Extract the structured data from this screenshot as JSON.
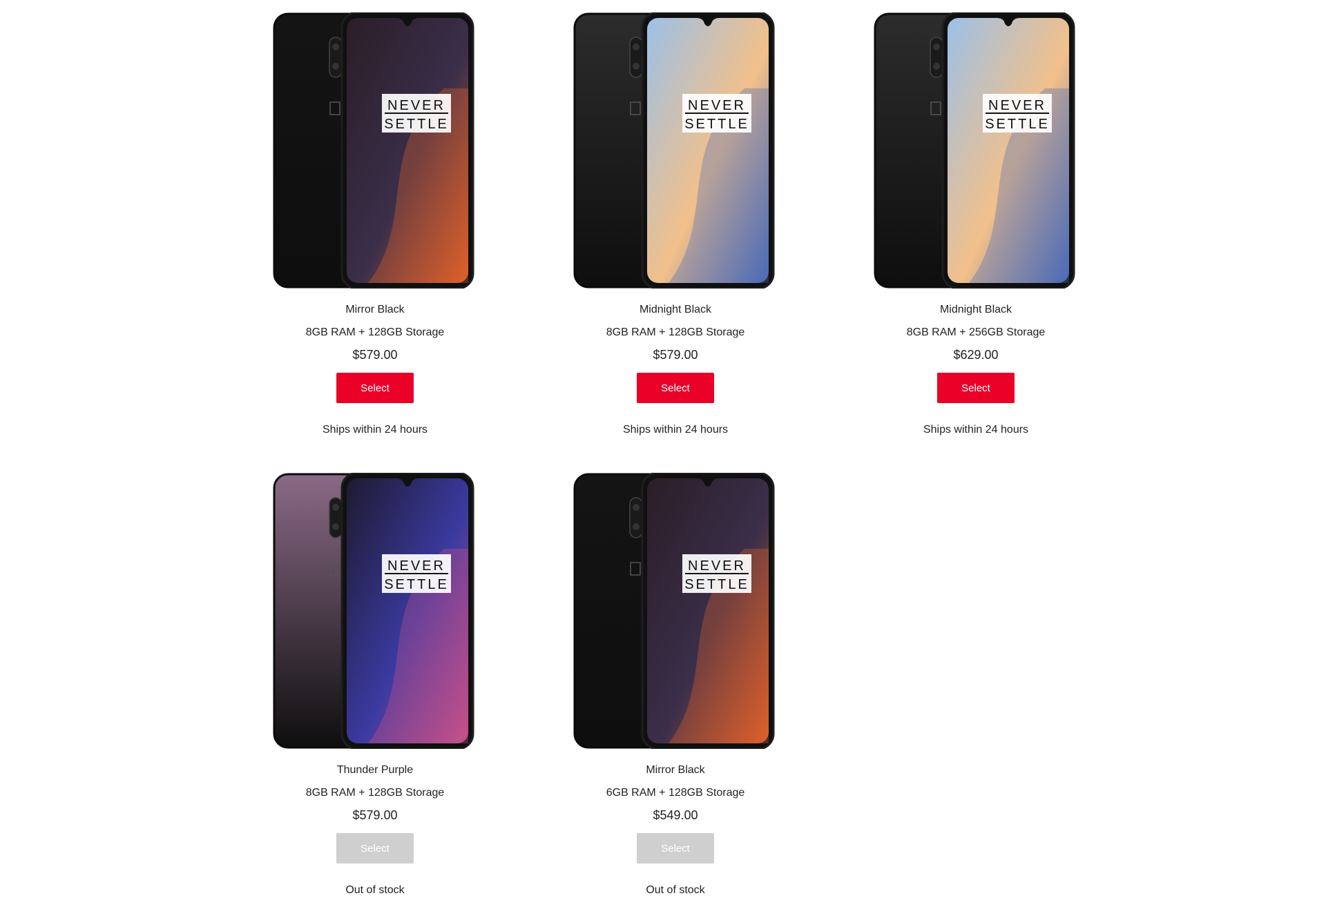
{
  "products": [
    {
      "color": "Mirror Black",
      "spec": "8GB RAM + 128GB Storage",
      "price": "$579.00",
      "button": "Select",
      "status": "Ships within 24 hours",
      "available": true,
      "badge_top": "NEVER",
      "badge_bottom": "SETTLE",
      "body_color": "#141414",
      "screen": [
        "#2a1e26",
        "#3a2e4a",
        "#e0602a"
      ]
    },
    {
      "color": "Midnight Black",
      "spec": "8GB RAM + 128GB Storage",
      "price": "$579.00",
      "button": "Select",
      "status": "Ships within 24 hours",
      "available": true,
      "badge_top": "NEVER",
      "badge_bottom": "SETTLE",
      "body_color": "#2c2c2c",
      "screen": [
        "#9cc0e8",
        "#f2c08a",
        "#4a6ab8"
      ]
    },
    {
      "color": "Midnight Black",
      "spec": "8GB RAM + 256GB Storage",
      "price": "$629.00",
      "button": "Select",
      "status": "Ships within 24 hours",
      "available": true,
      "badge_top": "NEVER",
      "badge_bottom": "SETTLE",
      "body_color": "#2c2c2c",
      "screen": [
        "#9cc0e8",
        "#f2c08a",
        "#4a6ab8"
      ]
    },
    {
      "color": "Thunder Purple",
      "spec": "8GB RAM + 128GB Storage",
      "price": "$579.00",
      "button": "Select",
      "status": "Out of stock",
      "available": false,
      "badge_top": "NEVER",
      "badge_bottom": "SETTLE",
      "body_color": "#8a6a86",
      "screen": [
        "#1e1a30",
        "#3a3aa0",
        "#c8508a"
      ]
    },
    {
      "color": "Mirror Black",
      "spec": "6GB RAM + 128GB Storage",
      "price": "$549.00",
      "button": "Select",
      "status": "Out of stock",
      "available": false,
      "badge_top": "NEVER",
      "badge_bottom": "SETTLE",
      "body_color": "#141414",
      "screen": [
        "#2a1e26",
        "#3a2e4a",
        "#e0602a"
      ]
    }
  ],
  "colors": {
    "accent": "#eb0028",
    "disabled": "#cfcfcf"
  }
}
